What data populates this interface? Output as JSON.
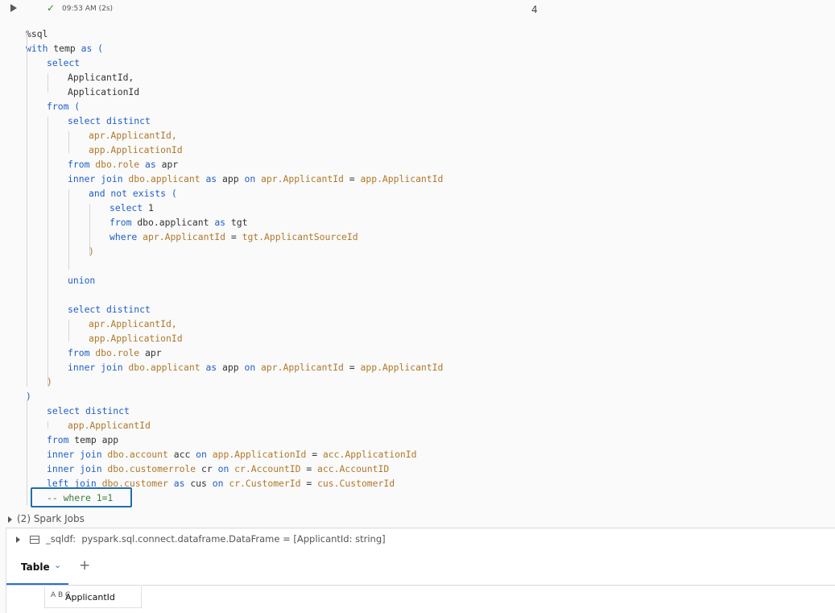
{
  "cell": {
    "status_time": "09:53 AM (2s)",
    "exec_count": "4"
  },
  "code_lines": [
    [
      {
        "t": "%sql",
        "c": "plain"
      }
    ],
    [
      {
        "t": "with",
        "c": "kw"
      },
      {
        "t": " temp ",
        "c": "plain"
      },
      {
        "t": "as",
        "c": "kw"
      },
      {
        "t": " (",
        "c": "kw"
      }
    ],
    [
      {
        "t": "select",
        "c": "kw"
      }
    ],
    [
      {
        "t": "ApplicantId,",
        "c": "plain"
      }
    ],
    [
      {
        "t": "ApplicationId",
        "c": "plain"
      }
    ],
    [
      {
        "t": "from",
        "c": "kw"
      },
      {
        "t": " (",
        "c": "kw"
      }
    ],
    [
      {
        "t": "select distinct",
        "c": "kw"
      }
    ],
    [
      {
        "t": "apr.ApplicantId,",
        "c": "obj"
      }
    ],
    [
      {
        "t": "app.ApplicationId",
        "c": "obj"
      }
    ],
    [
      {
        "t": "from",
        "c": "kw"
      },
      {
        "t": " dbo.role ",
        "c": "obj"
      },
      {
        "t": "as",
        "c": "kw"
      },
      {
        "t": " apr",
        "c": "plain"
      }
    ],
    [
      {
        "t": "inner join",
        "c": "kw"
      },
      {
        "t": " dbo.applicant ",
        "c": "obj"
      },
      {
        "t": "as",
        "c": "kw"
      },
      {
        "t": " app ",
        "c": "plain"
      },
      {
        "t": "on",
        "c": "kw"
      },
      {
        "t": " apr.ApplicantId ",
        "c": "obj"
      },
      {
        "t": "=",
        "c": "plain"
      },
      {
        "t": " app.ApplicantId",
        "c": "obj"
      }
    ],
    [
      {
        "t": "and not exists (",
        "c": "kw"
      }
    ],
    [
      {
        "t": "select",
        "c": "kw"
      },
      {
        "t": " 1",
        "c": "plain"
      }
    ],
    [
      {
        "t": "from",
        "c": "kw"
      },
      {
        "t": " dbo.applicant ",
        "c": "plain"
      },
      {
        "t": "as",
        "c": "kw"
      },
      {
        "t": " tgt",
        "c": "plain"
      }
    ],
    [
      {
        "t": "where",
        "c": "kw"
      },
      {
        "t": " apr.ApplicantId ",
        "c": "obj"
      },
      {
        "t": "=",
        "c": "plain"
      },
      {
        "t": " tgt.ApplicantSourceId",
        "c": "obj"
      }
    ],
    [
      {
        "t": ")",
        "c": "obj"
      }
    ],
    [],
    [
      {
        "t": "union",
        "c": "kw"
      }
    ],
    [],
    [
      {
        "t": "select distinct",
        "c": "kw"
      }
    ],
    [
      {
        "t": "apr.ApplicantId,",
        "c": "obj"
      }
    ],
    [
      {
        "t": "app.ApplicationId",
        "c": "obj"
      }
    ],
    [
      {
        "t": "from",
        "c": "kw"
      },
      {
        "t": " dbo.role ",
        "c": "obj"
      },
      {
        "t": "apr",
        "c": "plain"
      }
    ],
    [
      {
        "t": "inner join",
        "c": "kw"
      },
      {
        "t": " dbo.applicant ",
        "c": "obj"
      },
      {
        "t": "as",
        "c": "kw"
      },
      {
        "t": " app ",
        "c": "plain"
      },
      {
        "t": "on",
        "c": "kw"
      },
      {
        "t": " apr.ApplicantId ",
        "c": "obj"
      },
      {
        "t": "=",
        "c": "plain"
      },
      {
        "t": " app.ApplicantId",
        "c": "obj"
      }
    ],
    [
      {
        "t": ")",
        "c": "obj"
      }
    ],
    [
      {
        "t": ")",
        "c": "kw"
      }
    ],
    [
      {
        "t": "select distinct",
        "c": "kw"
      }
    ],
    [
      {
        "t": "app.ApplicantId",
        "c": "obj"
      }
    ],
    [
      {
        "t": "from",
        "c": "kw"
      },
      {
        "t": " temp app",
        "c": "plain"
      }
    ],
    [
      {
        "t": "inner join",
        "c": "kw"
      },
      {
        "t": " dbo.account ",
        "c": "obj"
      },
      {
        "t": "acc ",
        "c": "plain"
      },
      {
        "t": "on",
        "c": "kw"
      },
      {
        "t": " app.ApplicationId ",
        "c": "obj"
      },
      {
        "t": "=",
        "c": "plain"
      },
      {
        "t": " acc.ApplicationId",
        "c": "obj"
      }
    ],
    [
      {
        "t": "inner join",
        "c": "kw"
      },
      {
        "t": " dbo.customerrole ",
        "c": "obj"
      },
      {
        "t": "cr ",
        "c": "plain"
      },
      {
        "t": "on",
        "c": "kw"
      },
      {
        "t": " cr.AccountID ",
        "c": "obj"
      },
      {
        "t": "=",
        "c": "plain"
      },
      {
        "t": " acc.AccountID",
        "c": "obj"
      }
    ],
    [
      {
        "t": "left join",
        "c": "kw"
      },
      {
        "t": " dbo.customer ",
        "c": "obj"
      },
      {
        "t": "as",
        "c": "kw"
      },
      {
        "t": " cus ",
        "c": "plain"
      },
      {
        "t": "on",
        "c": "kw"
      },
      {
        "t": " cr.CustomerId ",
        "c": "obj"
      },
      {
        "t": "=",
        "c": "plain"
      },
      {
        "t": " cus.CustomerId",
        "c": "obj"
      }
    ],
    [
      {
        "t": "-- where 1=1",
        "c": "cmt"
      }
    ]
  ],
  "spark_jobs": "(2) Spark Jobs",
  "dataframe": {
    "name": "_sqldf:",
    "type": "pyspark.sql.connect.dataframe.DataFrame = [ApplicantId: string]"
  },
  "tabs": {
    "active": "Table",
    "add": "+"
  },
  "columns": [
    {
      "icon": "A B C",
      "name": "ApplicantId"
    }
  ]
}
